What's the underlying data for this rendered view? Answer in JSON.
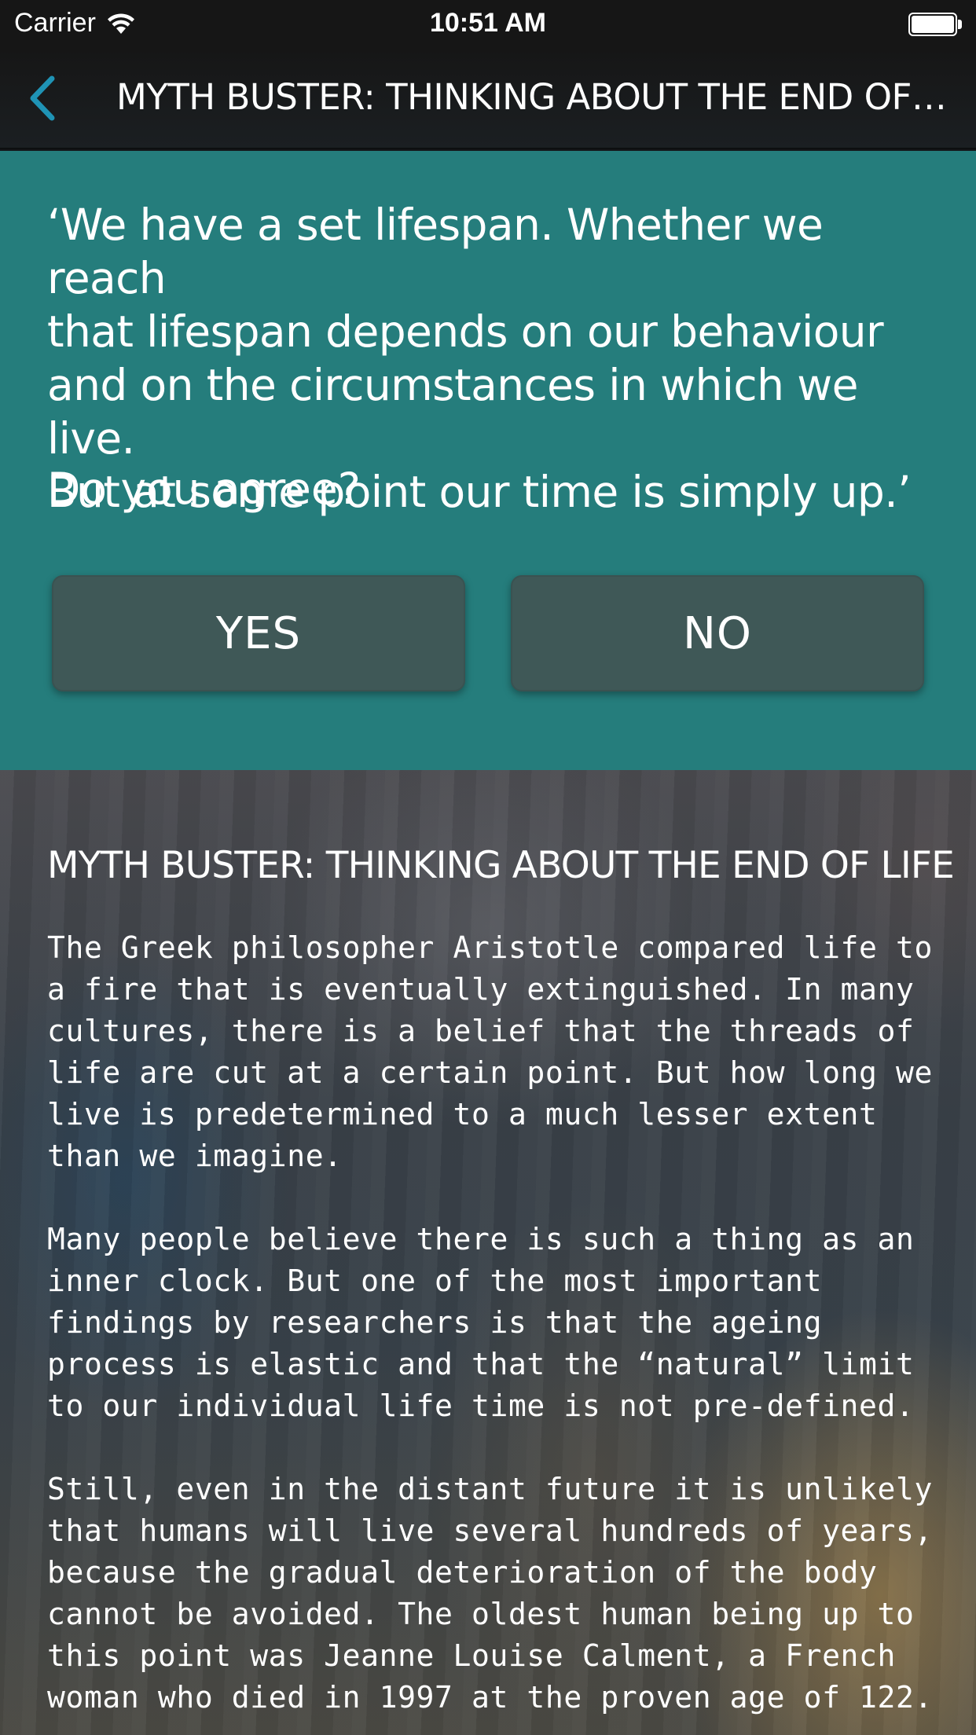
{
  "status_bar": {
    "carrier": "Carrier",
    "time": "10:51 AM"
  },
  "nav": {
    "title": "MYTH BUSTER: THINKING ABOUT THE END OF…",
    "back_icon": "chevron-left-icon",
    "accent_color": "#1f93b5"
  },
  "quiz": {
    "quote": "‘We have a set lifespan. Whether we reach\nthat lifespan depends on our behaviour\nand on the circumstances in which we live.\nBut at some point our time is simply up.’",
    "question": "Do you agree?",
    "yes_label": "YES",
    "no_label": "NO",
    "panel_color": "#257d7c",
    "button_color": "#3f5857"
  },
  "article": {
    "title": "MYTH BUSTER: THINKING ABOUT THE END OF LIFE",
    "paragraphs": [
      "The Greek philosopher Aristotle compared life to a fire that is eventually extinguished. In many cultures, there is a belief that the threads of life are cut at a certain point. But how long we live is predetermined to a much lesser extent than we imagine.",
      "Many people believe there is such a thing as an inner clock. But one of the most important findings by researchers is that the ageing process is elastic and that the “natural” limit to our individual life time is not pre-defined.",
      "Still, even in the distant future it is unlikely that humans will live several hundreds of years, because the gradual deterioration of the body cannot be avoided. The oldest human being up to this point was Jeanne Louise Calment, a French woman who died in 1997 at the proven age of 122."
    ]
  }
}
